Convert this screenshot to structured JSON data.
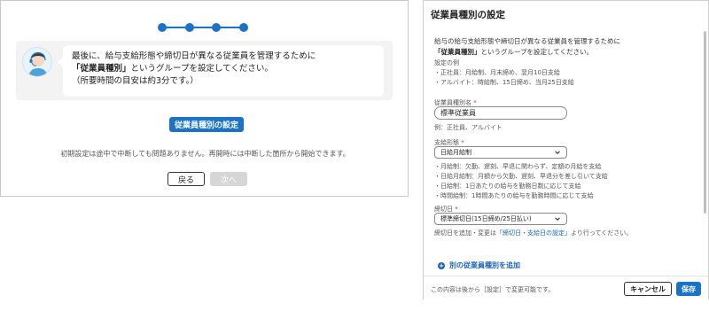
{
  "wizard": {
    "message_line1": "最後に、給与支給形態や締切日が異なる従業員を管理するために",
    "message_bold": "「従業員種別」",
    "message_line2_rest": "というグループを設定してください。",
    "message_line3": "（所要時間の目安は約3分です。）",
    "primary_button": "従業員種別の設定",
    "info_text": "初期設定は途中で中断しても問題ありません。再開時には中断した箇所から開始できます。",
    "back_button": "戻る",
    "next_button": "次へ",
    "accent_color": "#1a73c7"
  },
  "modal": {
    "title": "従業員種別の設定",
    "intro_line1": "給与の給与支給形態や締切日が異なる従業員を管理するために",
    "intro_bold": "「従業員種別」",
    "intro_line2_rest": "というグループを設定してください。",
    "example_heading": "設定の例",
    "examples": [
      "・正社員：月給制、月末締め、翌月10日支給",
      "・アルバイト：時給制、15日締め、当月25日支給"
    ],
    "name_label": "従業員種別名",
    "required_mark": "*",
    "name_value": "標準従業員",
    "name_hint": "例：正社員、アルバイト",
    "pay_type_label": "支給形態",
    "pay_type_value": "日給月給制",
    "pay_type_notes": [
      "・月給制：欠勤、遅刻、早退に関わらず、定額の月給を支給",
      "・日給月給制：月額から欠勤、遅刻、早退分を差し引いて支給",
      "・日給制：1日あたりの給与を勤務日数に応じて支給",
      "・時間給制：1時間あたりの給与を勤務時間に応じて支給"
    ],
    "cutoff_label": "締切日",
    "cutoff_value": "標準締切日(15日締め/25日払い)",
    "cutoff_note_prefix": "締切日を追加・変更は",
    "cutoff_note_link": "「締切日・支給日の設定」",
    "cutoff_note_suffix": "より行ってください。",
    "add_link": "別の従業員種別を追加",
    "footer_note": "この内容は後から［設定］で変更可能です。",
    "cancel_button": "キャンセル",
    "save_button": "保存"
  }
}
